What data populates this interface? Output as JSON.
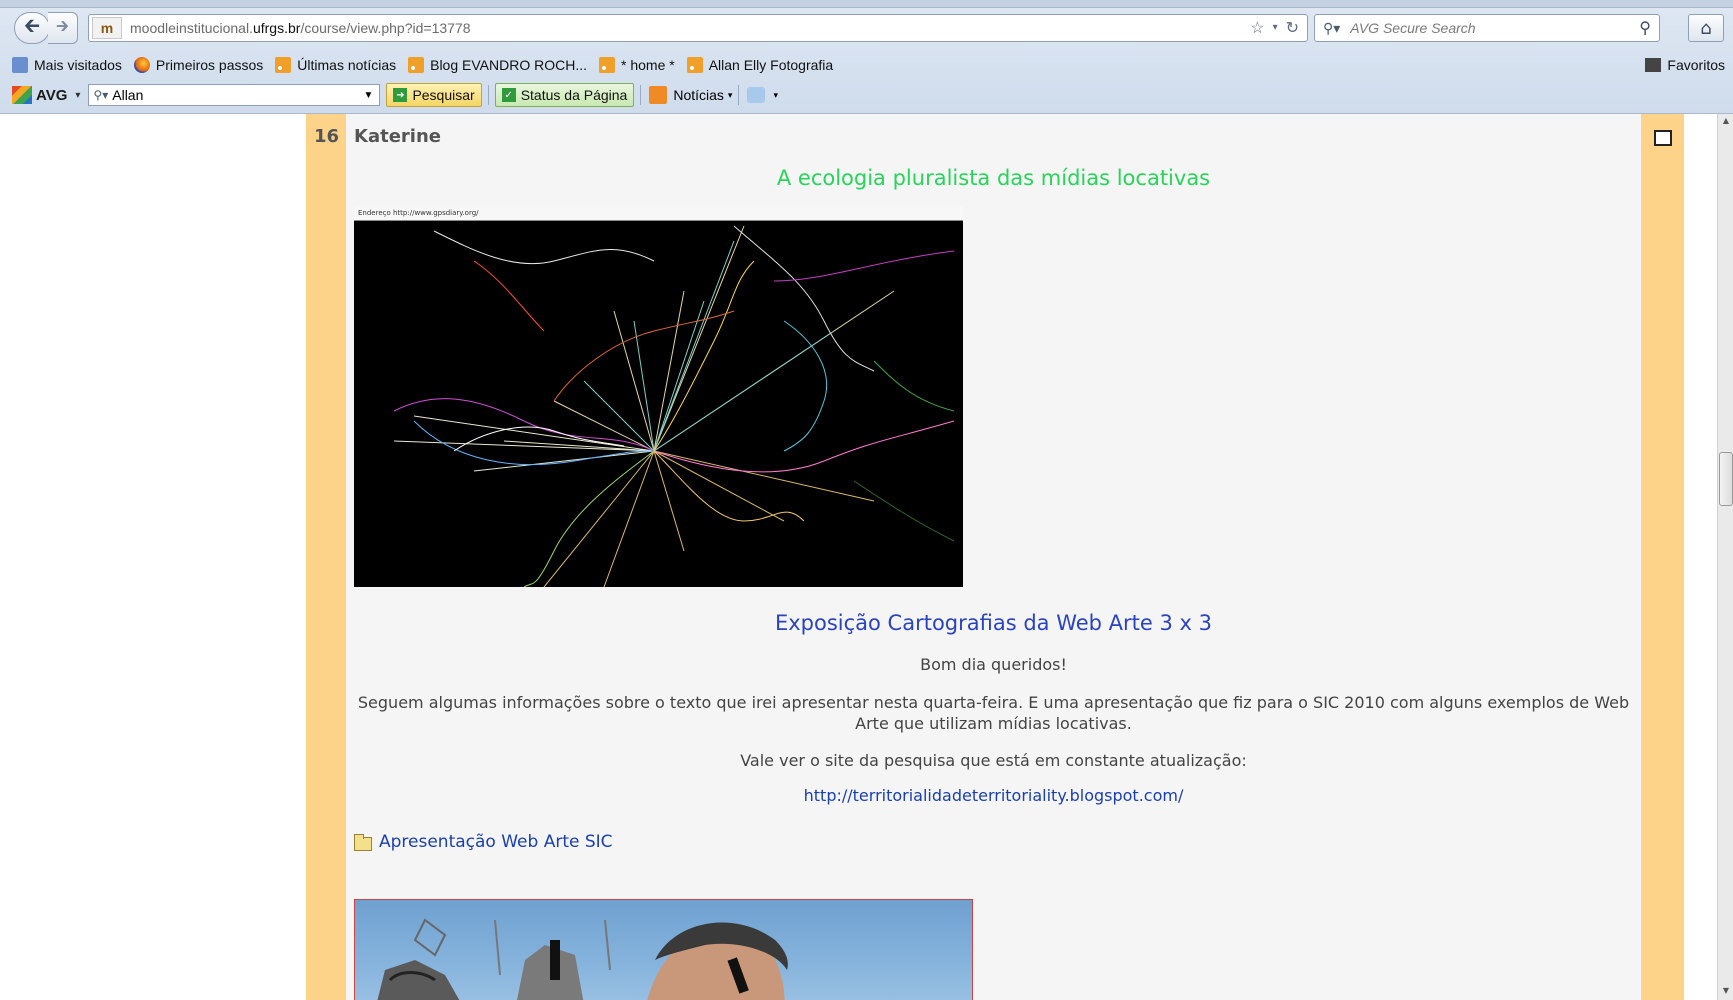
{
  "browser": {
    "url_prefix": "moodleinstitucional.",
    "url_domain": "ufrgs.br",
    "url_path": "/course/view.php?id=13778",
    "search_placeholder": "AVG Secure Search",
    "bookmarks": [
      {
        "label": "Mais visitados",
        "icon": "bookmark-icon"
      },
      {
        "label": "Primeiros passos",
        "icon": "firefox-icon"
      },
      {
        "label": "Últimas notícias",
        "icon": "rss-icon"
      },
      {
        "label": "Blog EVANDRO ROCH...",
        "icon": "rss-icon"
      },
      {
        "label": "* home *",
        "icon": "rss-icon"
      },
      {
        "label": "Allan Elly Fotografia",
        "icon": "rss-icon"
      }
    ],
    "favorites_label": "Favoritos",
    "avg_toolbar": {
      "logo": "AVG",
      "search_value": "Allan",
      "search_button": "Pesquisar",
      "status_button": "Status da Página",
      "news_button": "Notícias"
    }
  },
  "section": {
    "number": "16",
    "title": "Katerine",
    "heading_green": "A ecologia pluralista das mídias locativas",
    "image_caption_bar": "Endereço  http://www.gpsdiary.org/",
    "heading_blue": "Exposição Cartografias da Web Arte 3 x 3",
    "greeting": "Bom dia queridos!",
    "paragraph": "Seguem algumas informações sobre o texto que irei apresentar nesta quarta-feira. E uma apresentação que fiz para o SIC 2010 com alguns exemplos de Web Arte que utilizam mídias locativas.",
    "site_note": "Vale ver o site da pesquisa que está em constante atualização:",
    "link": "http://territorialidadeterritoriality.blogspot.com/",
    "resource_label": "Apresentação Web Arte SIC"
  },
  "colors": {
    "section_side": "#fdd38a",
    "green_heading": "#29d45b",
    "blue_heading": "#2a43c0",
    "link": "#1a3fb0"
  }
}
